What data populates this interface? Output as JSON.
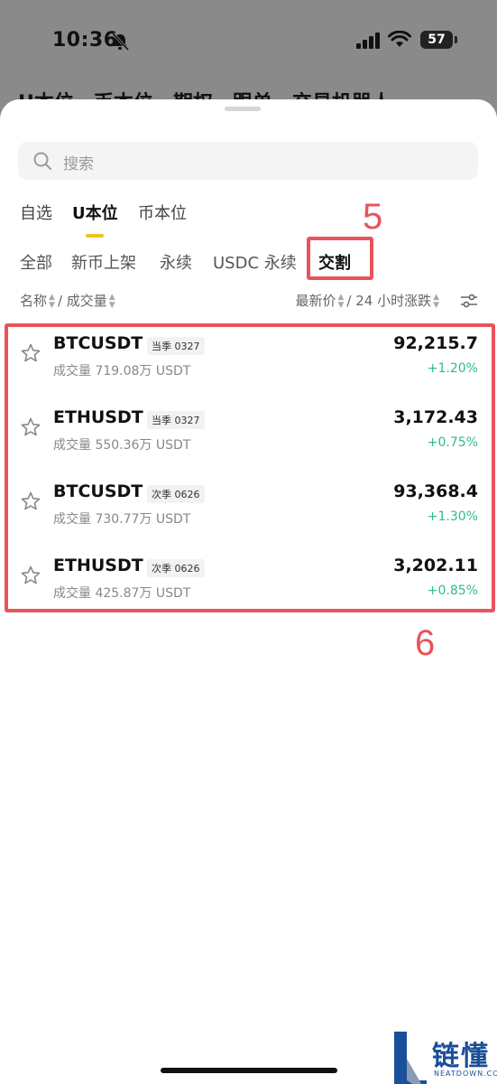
{
  "status": {
    "time": "10:36",
    "battery": "57"
  },
  "background_tabs": [
    "U本位",
    "币本位",
    "期权",
    "跟单",
    "交易机器人"
  ],
  "search": {
    "placeholder": "搜索"
  },
  "tabs": [
    {
      "label": "自选",
      "active": false
    },
    {
      "label": "U本位",
      "active": true
    },
    {
      "label": "币本位",
      "active": false
    }
  ],
  "subtabs": [
    {
      "label": "全部",
      "active": false
    },
    {
      "label": "新币上架",
      "active": false
    },
    {
      "label": "永续",
      "active": false
    },
    {
      "label": "USDC 永续",
      "active": false
    },
    {
      "label": "交割",
      "active": true
    }
  ],
  "sort_header": {
    "name": "名称",
    "sep1": "/",
    "volume": "成交量",
    "last_price": "最新价",
    "sep2": "/",
    "change24h": "24 小时涨跌"
  },
  "contracts": [
    {
      "symbol": "BTCUSDT",
      "badge": "当季 0327",
      "volume": "成交量 719.08万 USDT",
      "price": "92,215.7",
      "change": "+1.20%"
    },
    {
      "symbol": "ETHUSDT",
      "badge": "当季 0327",
      "volume": "成交量 550.36万 USDT",
      "price": "3,172.43",
      "change": "+0.75%"
    },
    {
      "symbol": "BTCUSDT",
      "badge": "次季 0626",
      "volume": "成交量 730.77万 USDT",
      "price": "93,368.4",
      "change": "+1.30%"
    },
    {
      "symbol": "ETHUSDT",
      "badge": "次季 0626",
      "volume": "成交量 425.87万 USDT",
      "price": "3,202.11",
      "change": "+0.85%"
    }
  ],
  "annotations": {
    "step5": "5",
    "step6": "6"
  },
  "watermark": {
    "text": "链懂",
    "sub": "NEATDOWN.COM"
  },
  "colors": {
    "accent": "#f0c419",
    "positive": "#2ebd85",
    "annotation": "#e8545c"
  }
}
